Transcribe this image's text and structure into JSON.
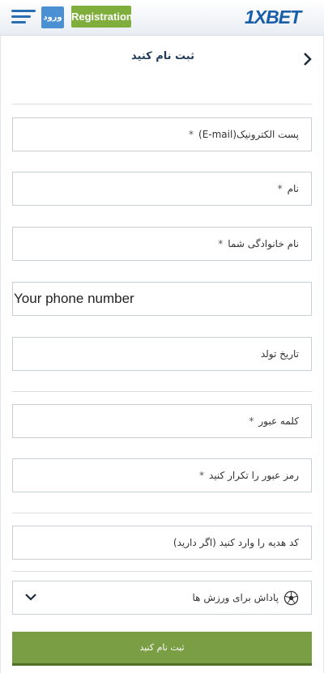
{
  "header": {
    "login_label": "ورود",
    "registration_label": "Registration",
    "logo_text": "1XBET"
  },
  "page": {
    "title": "ثبت نام کنید"
  },
  "form": {
    "email_label": "پست الکترونیک(E-mail)",
    "first_name_label": "نام",
    "last_name_label": "نام خانوادگی شما",
    "phone_placeholder": "Your phone number",
    "birthdate_label": "تاریخ تولد",
    "password_label": "کلمه عبور",
    "password_repeat_label": "رمز عبور را تکرار کنید",
    "promo_label": "کد هدیه را وارد کنید (اگر دارید)",
    "bonus_select_value": "پاداش برای ورزش ها",
    "required_mark": "*",
    "submit_label": "ثبت نام کنید"
  },
  "colors": {
    "brand_blue": "#1a5ea8",
    "login_blue": "#4a90d2",
    "registration_green": "#7fae3c",
    "submit_green": "#7a9e44"
  },
  "icons": {
    "menu": "hamburger-icon",
    "back": "chevron-right-icon",
    "bonus": "soccer-ball-icon",
    "dropdown": "chevron-down-icon"
  }
}
